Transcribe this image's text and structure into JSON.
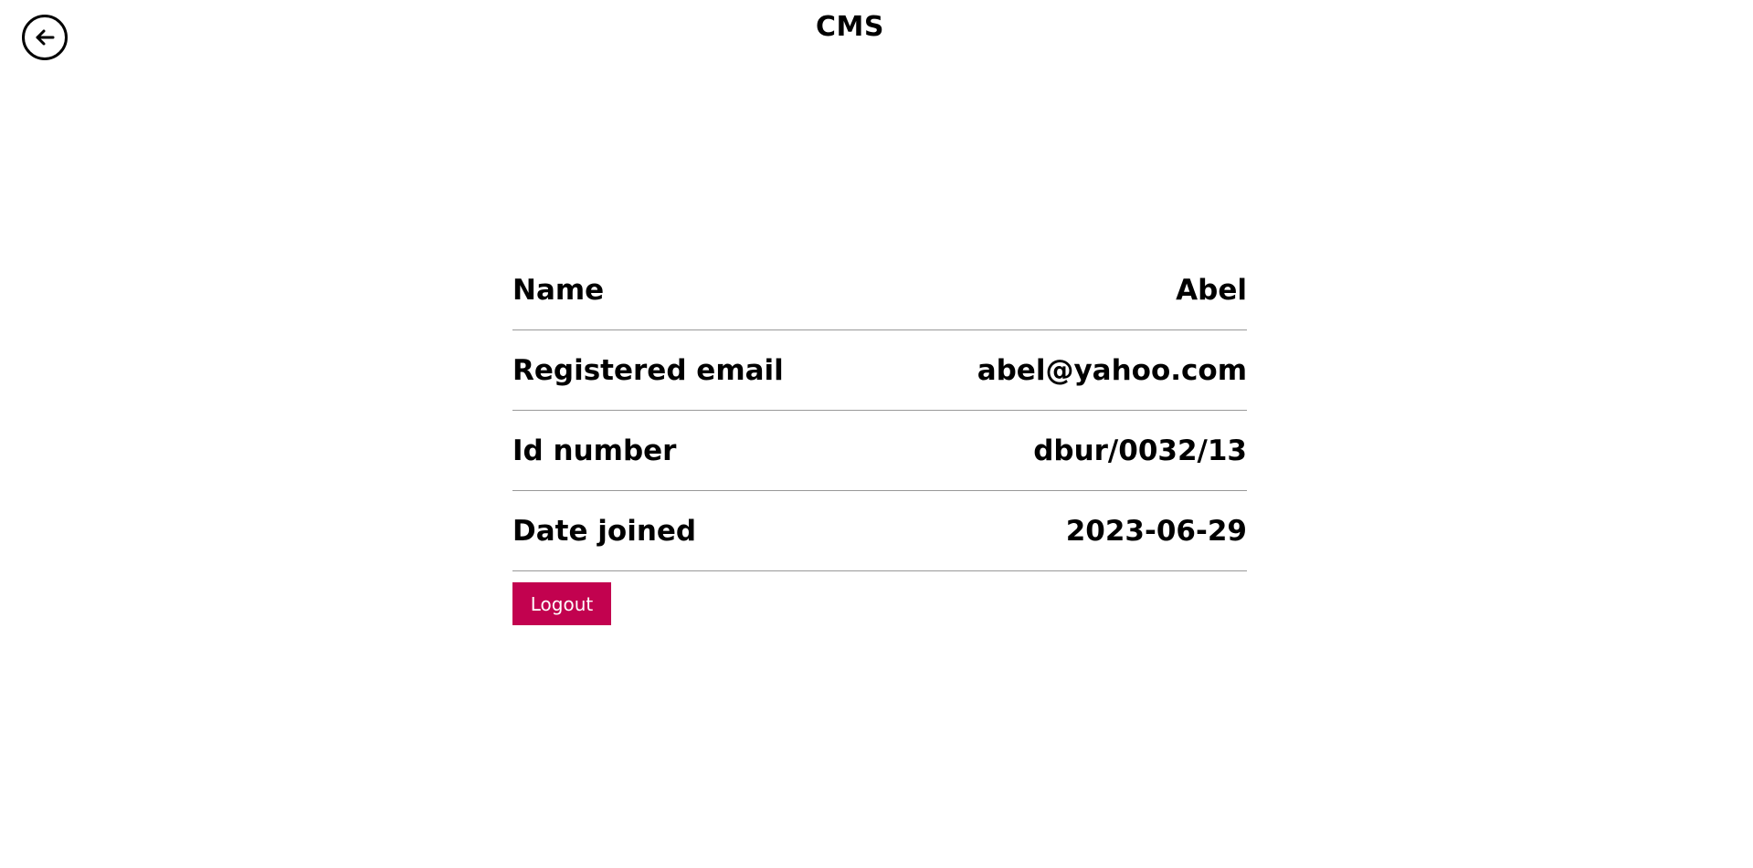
{
  "header": {
    "title": "CMS",
    "back_icon": "arrow-left-circle-icon"
  },
  "profile": {
    "rows": [
      {
        "label": "Name",
        "value": "Abel"
      },
      {
        "label": "Registered email",
        "value": "abel@yahoo.com"
      },
      {
        "label": "Id number",
        "value": "dbur/0032/13"
      },
      {
        "label": "Date joined",
        "value": "2023-06-29"
      }
    ]
  },
  "actions": {
    "logout_label": "Logout",
    "logout_color": "#c2024f"
  }
}
